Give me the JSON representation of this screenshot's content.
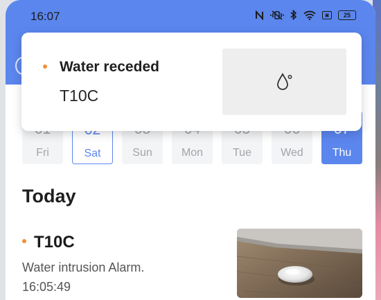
{
  "status_bar": {
    "time": "16:07",
    "battery": "25",
    "icons": [
      "nfc-icon",
      "mute-vibrate-icon",
      "bluetooth-icon",
      "wifi-icon",
      "sim-icon",
      "battery-icon"
    ]
  },
  "notification": {
    "title": "Water receded",
    "device": "T10C",
    "thumbnail_icon": "water-drop-icon"
  },
  "days": [
    {
      "num": "01",
      "name": "Fri",
      "state": "normal"
    },
    {
      "num": "02",
      "name": "Sat",
      "state": "selected"
    },
    {
      "num": "03",
      "name": "Sun",
      "state": "normal"
    },
    {
      "num": "04",
      "name": "Mon",
      "state": "normal"
    },
    {
      "num": "05",
      "name": "Tue",
      "state": "normal"
    },
    {
      "num": "06",
      "name": "Wed",
      "state": "normal"
    },
    {
      "num": "07",
      "name": "Thu",
      "state": "today"
    }
  ],
  "section": {
    "title": "Today"
  },
  "event": {
    "device": "T10C",
    "type": "Water intrusion Alarm.",
    "time": "16:05:49"
  },
  "colors": {
    "accent": "#5b86ee",
    "alert_dot": "#f19035"
  }
}
